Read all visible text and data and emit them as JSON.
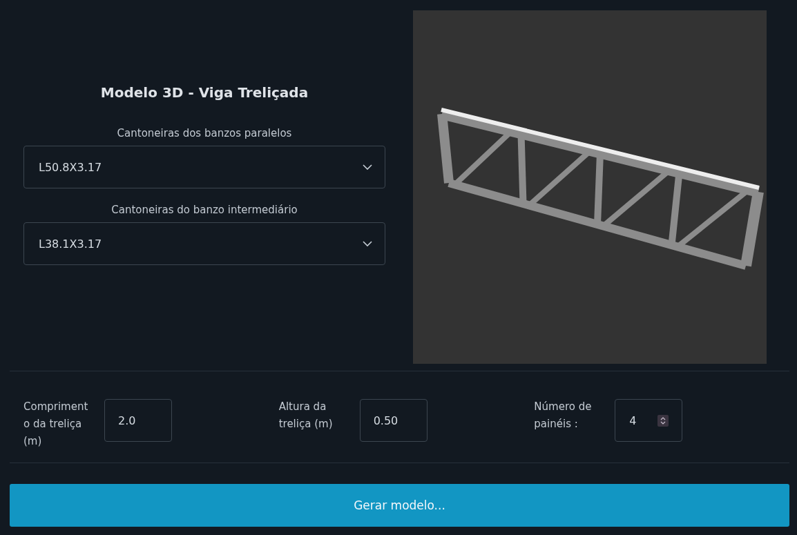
{
  "title": "Modelo 3D - Viga Treliçada",
  "selects": [
    {
      "label": "Cantoneiras dos banzos paralelos",
      "value": "L50.8X3.17"
    },
    {
      "label": "Cantoneiras do banzo intermediário",
      "value": "L38.1X3.17"
    }
  ],
  "fields": [
    {
      "kind": "text",
      "label": "Comprimento da treliça (m)",
      "value": "2.0"
    },
    {
      "kind": "text",
      "label": "Altura da treliça (m)",
      "value": "0.50"
    },
    {
      "kind": "number",
      "label": "Número de painéis :",
      "value": "4"
    }
  ],
  "button": "Gerar modelo..."
}
